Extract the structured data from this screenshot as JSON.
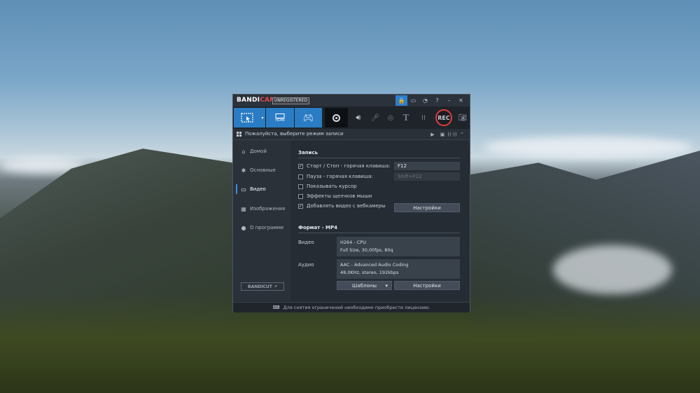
{
  "app": {
    "logo_part1": "BANDI",
    "logo_part2": "CAM",
    "unregistered": "UNREGISTERED"
  },
  "titlebar_icons": [
    "lock-icon",
    "folder-icon",
    "clock-icon",
    "help-icon",
    "minimize-icon",
    "close-icon"
  ],
  "titlebar_glyphs": {
    "lock": "🔒",
    "folder": "▭",
    "clock": "◔",
    "help": "?",
    "minimize": "–",
    "close": "✕"
  },
  "toolbar": {
    "hdmi_label": "HDMI",
    "rec_label": "REC",
    "text_label": "T",
    "pause_label": "II"
  },
  "modebar": {
    "text": "Пожалуйста, выберите режим записи"
  },
  "sidebar": {
    "items": [
      {
        "label": "Домой",
        "icon": "home-icon",
        "glyph": "⌂"
      },
      {
        "label": "Основные",
        "icon": "gear-icon",
        "glyph": "✱"
      },
      {
        "label": "Видео",
        "icon": "video-icon",
        "glyph": "▭"
      },
      {
        "label": "Изображения",
        "icon": "image-icon",
        "glyph": "▦"
      },
      {
        "label": "О программе",
        "icon": "info-icon",
        "glyph": "●"
      }
    ],
    "active": "Видео",
    "bandicut": "BANDICUT ↗"
  },
  "recording": {
    "title": "Запись",
    "start_stop_label": "Старт / Стоп - горячая клавиша:",
    "start_stop_checked": true,
    "start_stop_value": "F12",
    "pause_label": "Пауза - горячая клавиша:",
    "pause_checked": false,
    "pause_value": "Shift+F12",
    "show_cursor_label": "Показывать курсор",
    "show_cursor_checked": false,
    "click_effects_label": "Эффекты щелчков мыши",
    "click_effects_checked": false,
    "webcam_label": "Добавлять видео с вебкамеры",
    "webcam_checked": true,
    "settings_button": "Настройки"
  },
  "format": {
    "title": "Формат - MP4",
    "video_label": "Видео",
    "video_line1": "H264 - CPU",
    "video_line2": "Full Size, 30,00fps, 80q",
    "audio_label": "Аудио",
    "audio_line1": "AAC - Advanced Audio Coding",
    "audio_line2": "48,0KHz, stereo, 192kbps",
    "templates_button": "Шаблоны",
    "settings_button": "Настройки"
  },
  "footer": {
    "text": "Для снятия ограничений необходимо приобрести лицензию."
  },
  "colors": {
    "accent_blue": "#2a7cc4",
    "rec_red": "#e23b3b"
  }
}
